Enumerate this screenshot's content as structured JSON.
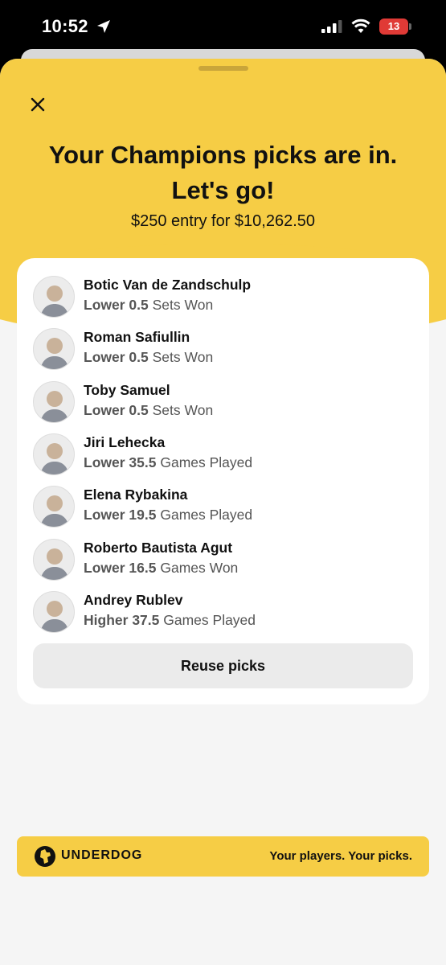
{
  "status_bar": {
    "time": "10:52",
    "battery": "13"
  },
  "header": {
    "title_line1": "Your Champions picks are in.",
    "title_line2": "Let's go!",
    "subtitle": "$250 entry for $10,262.50"
  },
  "picks": [
    {
      "name": "Botic Van de Zandschulp",
      "direction": "Lower",
      "line": "0.5",
      "stat": "Sets Won"
    },
    {
      "name": "Roman Safiullin",
      "direction": "Lower",
      "line": "0.5",
      "stat": "Sets Won"
    },
    {
      "name": "Toby Samuel",
      "direction": "Lower",
      "line": "0.5",
      "stat": "Sets Won"
    },
    {
      "name": "Jiri Lehecka",
      "direction": "Lower",
      "line": "35.5",
      "stat": "Games Played"
    },
    {
      "name": "Elena Rybakina",
      "direction": "Lower",
      "line": "19.5",
      "stat": "Games Played"
    },
    {
      "name": "Roberto Bautista Agut",
      "direction": "Lower",
      "line": "16.5",
      "stat": "Games Won"
    },
    {
      "name": "Andrey Rublev",
      "direction": "Higher",
      "line": "37.5",
      "stat": "Games Played"
    }
  ],
  "actions": {
    "reuse_label": "Reuse picks"
  },
  "banner": {
    "brand": "UNDERDOG",
    "tagline": "Your players. Your picks."
  },
  "colors": {
    "brand_yellow": "#f6cd45",
    "battery_red": "#e03a36"
  }
}
